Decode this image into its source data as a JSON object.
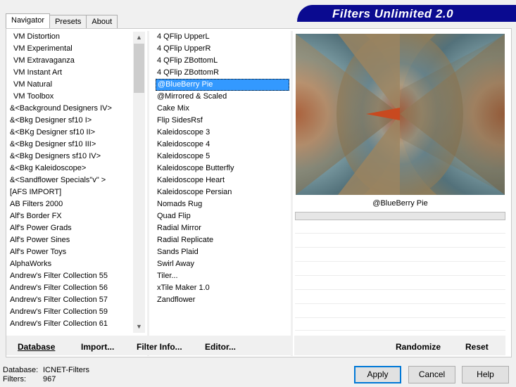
{
  "window": {
    "banner_title": "Filters Unlimited 2.0"
  },
  "tabs": [
    {
      "label": "Navigator",
      "active": true
    },
    {
      "label": "Presets",
      "active": false
    },
    {
      "label": "About",
      "active": false
    }
  ],
  "categories": [
    "VM Distortion",
    "VM Experimental",
    "VM Extravaganza",
    "VM Instant Art",
    "VM Natural",
    "VM Toolbox",
    "&<Background Designers IV>",
    "&<Bkg Designer sf10 I>",
    "&<BKg Designer sf10 II>",
    "&<Bkg Designer sf10 III>",
    "&<Bkg Designers sf10 IV>",
    "&<Bkg Kaleidoscope>",
    "&<Sandflower Specials\"v\" >",
    "[AFS IMPORT]",
    "AB Filters 2000",
    "Alf's Border FX",
    "Alf's Power Grads",
    "Alf's Power Sines",
    "Alf's Power Toys",
    "AlphaWorks",
    "Andrew's Filter Collection 55",
    "Andrew's Filter Collection 56",
    "Andrew's Filter Collection 57",
    "Andrew's Filter Collection 59",
    "Andrew's Filter Collection 61"
  ],
  "filters": [
    "4 QFlip UpperL",
    "4 QFlip UpperR",
    "4 QFlip ZBottomL",
    "4 QFlip ZBottomR",
    "@BlueBerry Pie",
    "@Mirrored & Scaled",
    "Cake Mix",
    "Flip SidesRsf",
    "Kaleidoscope 3",
    "Kaleidoscope 4",
    "Kaleidoscope 5",
    "Kaleidoscope Butterfly",
    "Kaleidoscope Heart",
    "Kaleidoscope Persian",
    "Nomads Rug",
    "Quad Flip",
    "Radial Mirror",
    "Radial Replicate",
    "Sands Plaid",
    "Swirl Away",
    "Tiler...",
    "xTile Maker 1.0",
    "Zandflower"
  ],
  "selected_filter_index": 4,
  "preview": {
    "label": "@BlueBerry Pie"
  },
  "toolbar": {
    "database_label": "Database",
    "import_label": "Import...",
    "filter_info_label": "Filter Info...",
    "editor_label": "Editor...",
    "randomize_label": "Randomize",
    "reset_label": "Reset"
  },
  "status": {
    "database_label": "Database:",
    "database_value": "ICNET-Filters",
    "filters_label": "Filters:",
    "filters_value": "967"
  },
  "buttons": {
    "apply": "Apply",
    "cancel": "Cancel",
    "help": "Help"
  },
  "colors": {
    "banner": "#0a0a90",
    "selection": "#3399ff",
    "default_button_border": "#0078d7"
  }
}
